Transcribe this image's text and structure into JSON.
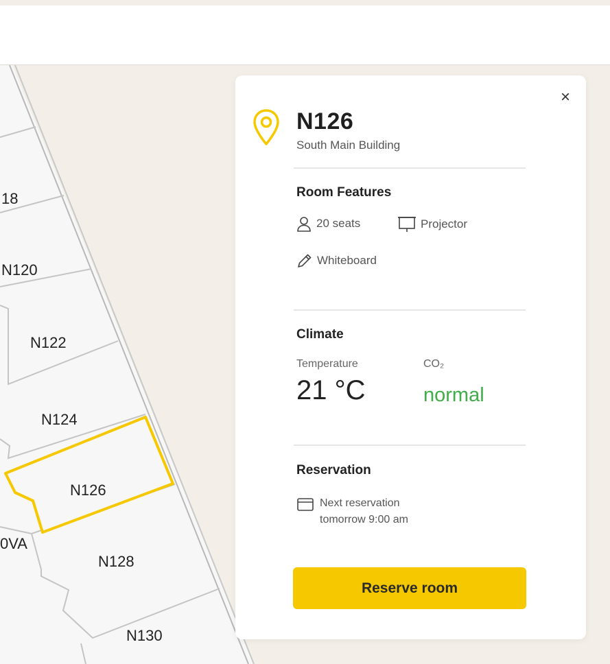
{
  "map": {
    "rooms": [
      {
        "label": "18"
      },
      {
        "label": "N120"
      },
      {
        "label": "N122"
      },
      {
        "label": "N124"
      },
      {
        "label": "N126",
        "selected": true
      },
      {
        "label": "0VA"
      },
      {
        "label": "N128"
      },
      {
        "label": "N130"
      }
    ],
    "highlight_color": "#f5c800"
  },
  "panel": {
    "close_label": "×",
    "room_name": "N126",
    "building": "South Main Building",
    "features": {
      "title": "Room Features",
      "seats": "20 seats",
      "projector": "Projector",
      "whiteboard": "Whiteboard"
    },
    "climate": {
      "title": "Climate",
      "temperature_label": "Temperature",
      "temperature_value": "21 °C",
      "co2_label": "CO₂",
      "co2_value": "normal",
      "co2_color": "#3fae49"
    },
    "reservation": {
      "title": "Reservation",
      "line1": "Next reservation",
      "line2": "tomorrow 9:00 am"
    },
    "reserve_button": "Reserve room",
    "accent_color": "#f5c800"
  }
}
